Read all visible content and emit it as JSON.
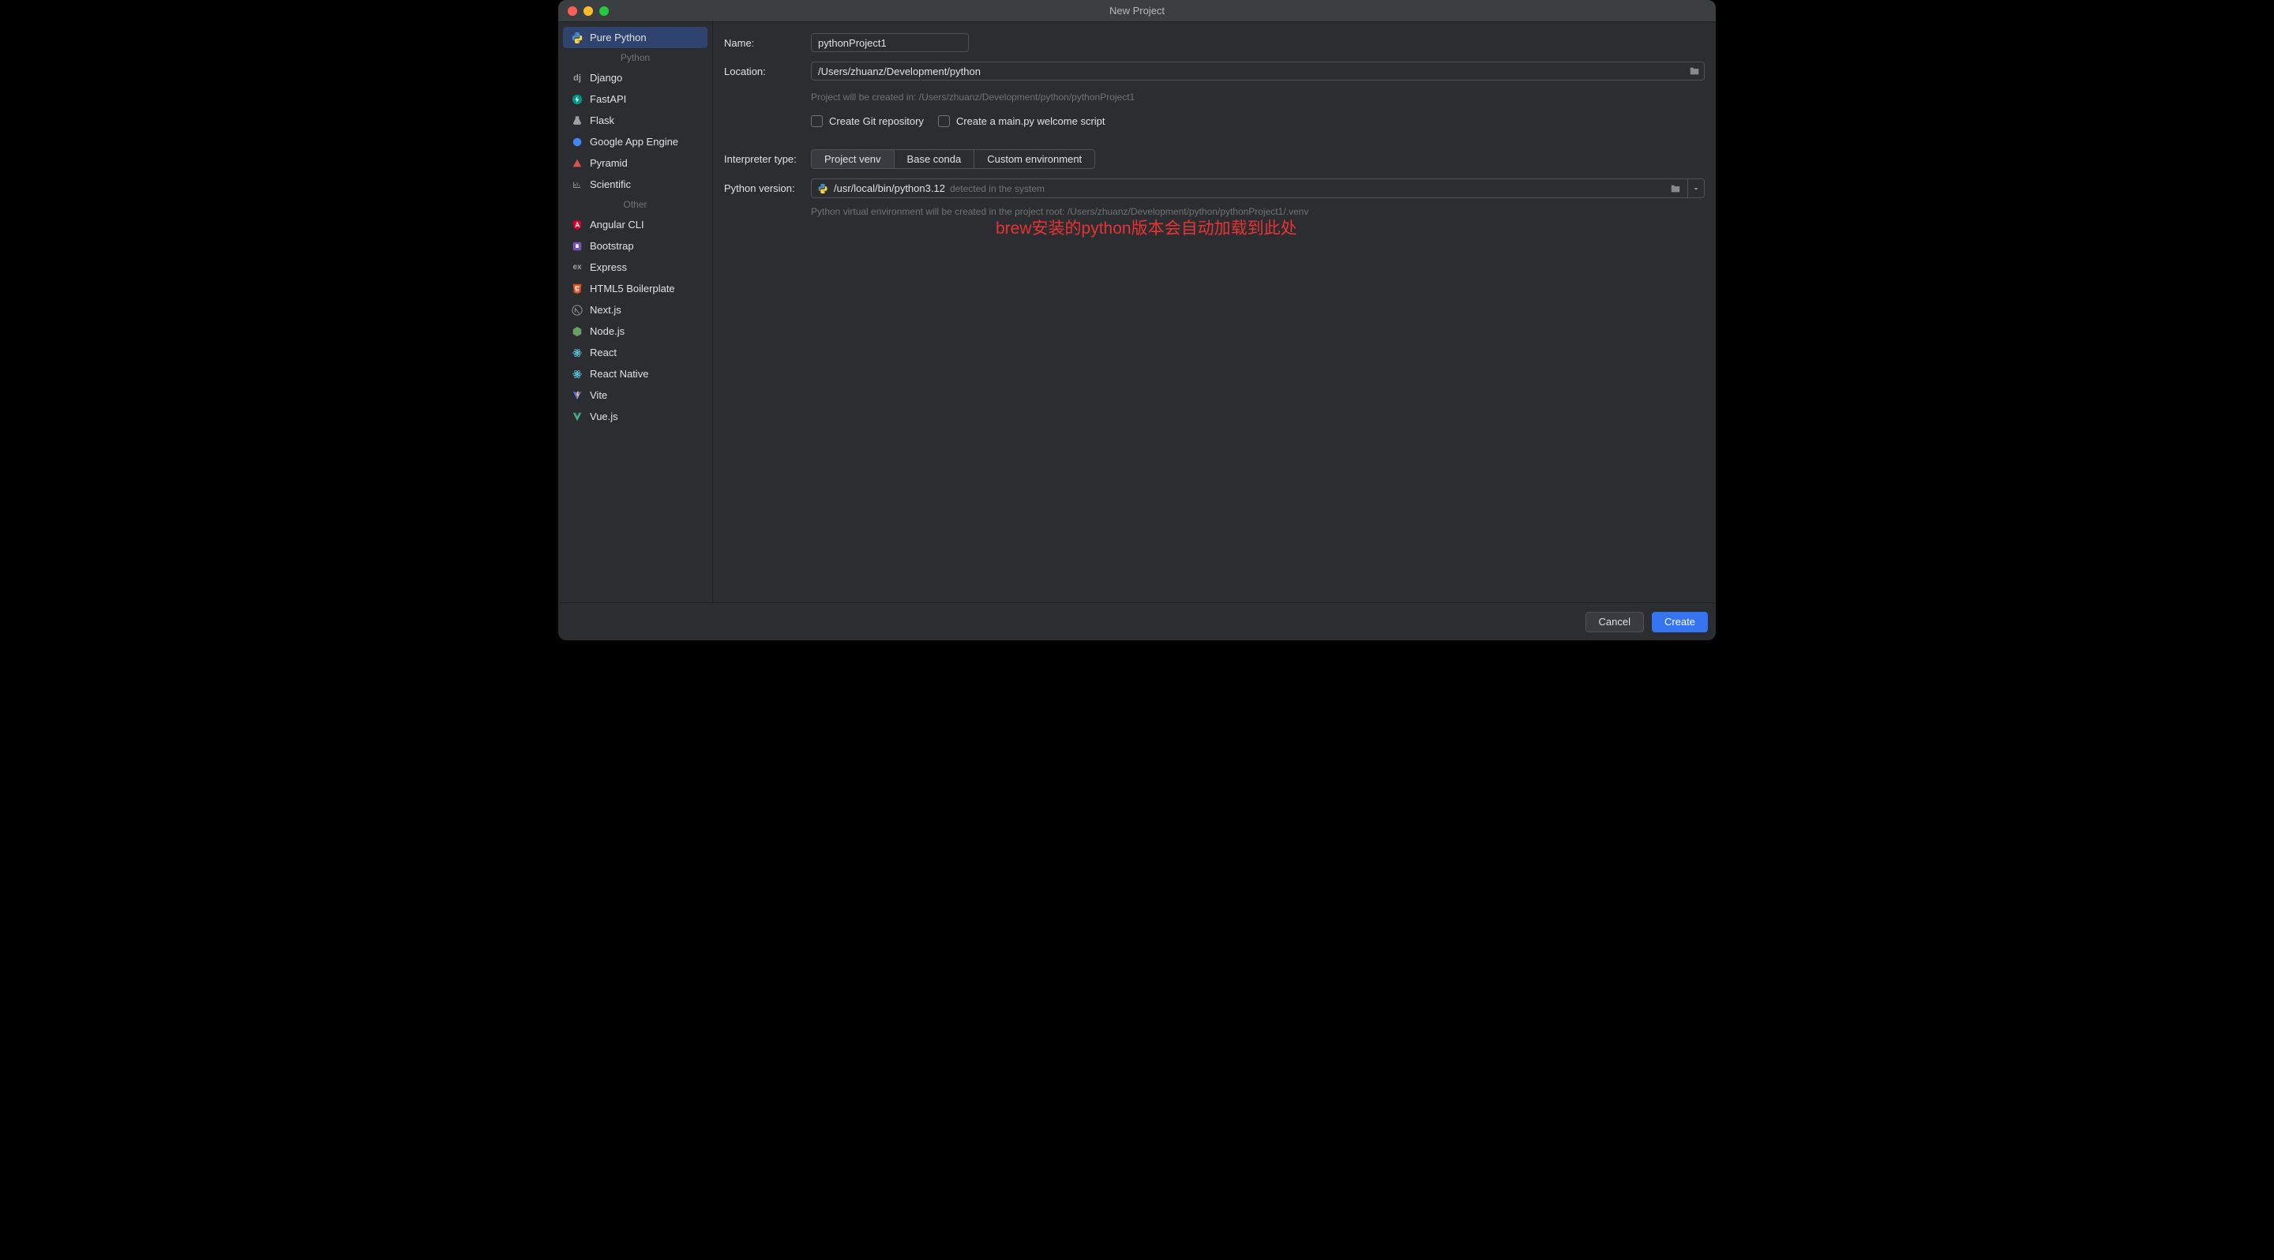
{
  "window": {
    "title": "New Project"
  },
  "sidebar": {
    "headers": {
      "python": "Python",
      "other": "Other"
    },
    "pure_python": "Pure Python",
    "django": "Django",
    "fastapi": "FastAPI",
    "flask": "Flask",
    "gae": "Google App Engine",
    "pyramid": "Pyramid",
    "scientific": "Scientific",
    "angular": "Angular CLI",
    "bootstrap": "Bootstrap",
    "express": "Express",
    "html5": "HTML5 Boilerplate",
    "nextjs": "Next.js",
    "nodejs": "Node.js",
    "react": "React",
    "react_native": "React Native",
    "vite": "Vite",
    "vuejs": "Vue.js"
  },
  "form": {
    "name_label": "Name:",
    "name_value": "pythonProject1",
    "location_label": "Location:",
    "location_value": "/Users/zhuanz/Development/python",
    "path_hint": "Project will be created in: /Users/zhuanz/Development/python/pythonProject1",
    "git_label": "Create Git repository",
    "mainpy_label": "Create a main.py welcome script",
    "interpreter_label": "Interpreter type:",
    "seg": {
      "venv": "Project venv",
      "conda": "Base conda",
      "custom": "Custom environment"
    },
    "version_label": "Python version:",
    "version_path": "/usr/local/bin/python3.12",
    "version_hint": "detected in the system",
    "venv_hint": "Python virtual environment will be created in the project root: /Users/zhuanz/Development/python/pythonProject1/.venv"
  },
  "annotation": "brew安装的python版本会自动加载到此处",
  "footer": {
    "cancel": "Cancel",
    "create": "Create"
  }
}
